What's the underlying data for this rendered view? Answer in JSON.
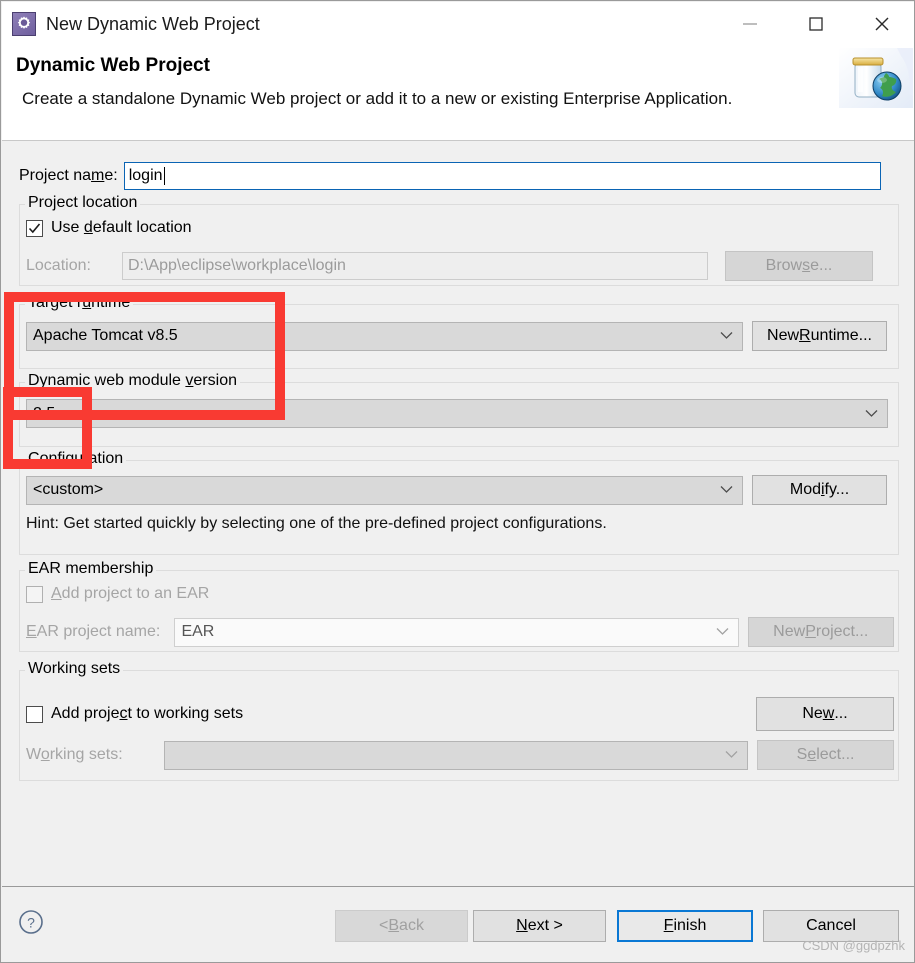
{
  "window": {
    "title": "New Dynamic Web Project",
    "icon": "cog-icon",
    "minimize_label": "—",
    "maximize_label": "□",
    "close_label": "✕"
  },
  "header": {
    "title": "Dynamic Web Project",
    "description": "Create a standalone Dynamic Web project or add it to a new or existing Enterprise Application.",
    "icon": "web-project-jar-globe-icon"
  },
  "project_name": {
    "label_pre": "Project na",
    "label_mnemonic": "m",
    "label_post": "e:",
    "value": "login"
  },
  "project_location": {
    "group_title": "Project location",
    "use_default_pre": "Use ",
    "use_default_mnemonic": "d",
    "use_default_post": "efault location",
    "use_default_checked": true,
    "location_label": "Location:",
    "location_value": "D:\\App\\eclipse\\workplace\\login",
    "browse_label_pre": "Brow",
    "browse_label_mnemonic": "s",
    "browse_label_post": "e...",
    "browse_enabled": false
  },
  "target_runtime": {
    "group_title_pre": "Target r",
    "group_title_mnemonic": "u",
    "group_title_post": "ntime",
    "value": "Apache Tomcat v8.5",
    "new_runtime_pre": "New ",
    "new_runtime_mnemonic": "R",
    "new_runtime_post": "untime..."
  },
  "web_module": {
    "group_title_pre": "Dynamic web module ",
    "group_title_mnemonic": "v",
    "group_title_post": "ersion",
    "value": "2.5"
  },
  "configuration": {
    "group_title_pre": "",
    "group_title_mnemonic": "C",
    "group_title_post": "onfiguration",
    "value": "<custom>",
    "modify_pre": "Mod",
    "modify_mnemonic": "i",
    "modify_post": "fy...",
    "hint": "Hint: Get started quickly by selecting one of the pre-defined project configurations."
  },
  "ear_membership": {
    "group_title": "EAR membership",
    "add_to_ear_pre": "",
    "add_to_ear_mnemonic": "A",
    "add_to_ear_post": "dd project to an EAR",
    "add_to_ear_checked": false,
    "ear_name_label_pre": "",
    "ear_name_label_mnemonic": "E",
    "ear_name_label_post": "AR project name:",
    "ear_name_value": "EAR",
    "new_project_pre": "New ",
    "new_project_mnemonic": "P",
    "new_project_post": "roject...",
    "enabled": false
  },
  "working_sets": {
    "group_title": "Working sets",
    "add_to_ws_pre": "Add proje",
    "add_to_ws_mnemonic": "c",
    "add_to_ws_post": "t to working sets",
    "add_to_ws_checked": false,
    "new_pre": "Ne",
    "new_mnemonic": "w",
    "new_post": "...",
    "ws_label_pre": "W",
    "ws_label_mnemonic": "o",
    "ws_label_post": "rking sets:",
    "ws_value": "",
    "select_pre": "S",
    "select_mnemonic": "e",
    "select_post": "lect..."
  },
  "footer": {
    "help_icon": "help-question-icon",
    "back_pre": "< ",
    "back_mnemonic": "B",
    "back_post": "ack",
    "back_enabled": false,
    "next_pre": "",
    "next_mnemonic": "N",
    "next_post": "ext >",
    "finish_pre": "",
    "finish_mnemonic": "F",
    "finish_post": "inish",
    "cancel_label": "Cancel",
    "watermark": "CSDN @ggdpzhk"
  },
  "annotations": {
    "accent_color": "#f93a32",
    "boxes": [
      {
        "name": "target-runtime-highlight"
      },
      {
        "name": "web-module-version-highlight"
      }
    ]
  }
}
